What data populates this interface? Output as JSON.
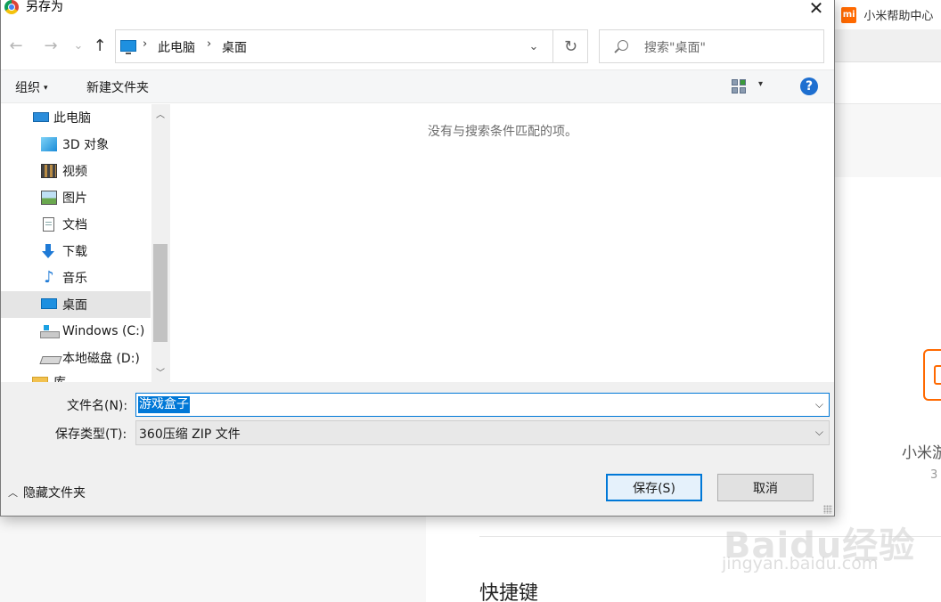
{
  "browser": {
    "tab_title": "小米帮助中心",
    "logo_text": "mi",
    "app_name": "小米游",
    "app_sub": "3",
    "section_title": "快捷键"
  },
  "watermark": {
    "brand": "Baidu经验",
    "site": "jingyan.baidu.com"
  },
  "dialog": {
    "title": "另存为",
    "close_glyph": "✕",
    "nav": {
      "back": "←",
      "forward": "→",
      "recent": "⌄",
      "up": "↑"
    },
    "address": {
      "crumbs": [
        "此电脑",
        "桌面"
      ],
      "separator": "›",
      "dropdown": "⌄",
      "refresh": "↻"
    },
    "search": {
      "placeholder": "搜索\"桌面\""
    },
    "commandbar": {
      "organize": "组织",
      "organize_caret": "▾",
      "new_folder": "新建文件夹",
      "view_caret": "▾",
      "help": "?"
    },
    "navpane": {
      "items": [
        {
          "label": "此电脑",
          "icon": "computer-icon"
        },
        {
          "label": "3D 对象",
          "icon": "3d-objects-icon"
        },
        {
          "label": "视频",
          "icon": "video-icon"
        },
        {
          "label": "图片",
          "icon": "pictures-icon"
        },
        {
          "label": "文档",
          "icon": "documents-icon"
        },
        {
          "label": "下载",
          "icon": "download-icon"
        },
        {
          "label": "音乐",
          "icon": "music-icon"
        },
        {
          "label": "桌面",
          "icon": "desktop-icon",
          "selected": true
        },
        {
          "label": "Windows (C:)",
          "icon": "windows-drive-icon"
        },
        {
          "label": "本地磁盘 (D:)",
          "icon": "drive-icon"
        },
        {
          "label": "库",
          "icon": "folder-icon"
        }
      ],
      "scroll_up": "︿",
      "scroll_down": "﹀",
      "music_glyph": "♪"
    },
    "content": {
      "empty_message": "没有与搜索条件匹配的项。"
    },
    "form": {
      "filename_label": "文件名(N):",
      "filename_value": "游戏盒子",
      "filetype_label": "保存类型(T):",
      "filetype_value": "360压缩 ZIP 文件",
      "dropdown_glyph": "⌵"
    },
    "footer": {
      "hide_folders": "隐藏文件夹",
      "hide_caret": "︿",
      "save": "保存(S)",
      "cancel": "取消"
    }
  },
  "colors": {
    "accent": "#0078d7",
    "help": "#1e6fd0",
    "mi_orange": "#ff6900"
  }
}
